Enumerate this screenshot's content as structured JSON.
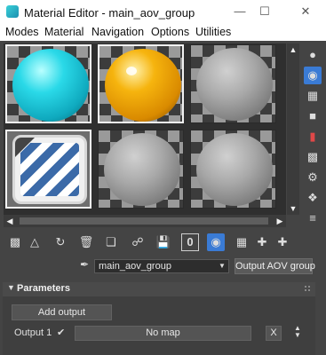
{
  "window": {
    "title": "Material Editor - main_aov_group",
    "controls": [
      "minimize-icon",
      "maximize-icon",
      "close-icon"
    ]
  },
  "menubar": [
    "Modes",
    "Material",
    "Navigation",
    "Options",
    "Utilities"
  ],
  "sample_slots": [
    {
      "preview": "cyan-sphere",
      "active": true
    },
    {
      "preview": "gold-sphere",
      "active": true
    },
    {
      "preview": "grey-sphere",
      "active": false
    },
    {
      "preview": "decal-sticker",
      "active": true
    },
    {
      "preview": "grey-sphere",
      "active": false
    },
    {
      "preview": "grey-sphere",
      "active": false
    }
  ],
  "side_toolbar_icons": [
    "sample-type-icon",
    "backlight-icon",
    "background-icon",
    "uv-tiling-icon",
    "video-color-check-icon",
    "make-preview-icon",
    "options-icon",
    "select-by-material-icon",
    "material-map-navigator-icon"
  ],
  "bottom_toolbar_icons": [
    "get-material-icon",
    "put-to-scene-icon",
    "assign-to-selection-icon",
    "delete-icon",
    "make-unique-icon",
    "put-to-library-icon",
    "save-icon",
    "material-id-icon",
    "show-shaded-icon",
    "show-end-result-icon",
    "go-to-parent-icon",
    "go-forward-icon"
  ],
  "material_id_channel": "0",
  "material": {
    "name": "main_aov_group",
    "type_button": "Output AOV group"
  },
  "parameters": {
    "title": "Parameters",
    "add_output": "Add output",
    "output_label": "Output 1",
    "checkbox_mark": "✔",
    "map_button": "No map",
    "remove_button": "X"
  },
  "colors": {
    "panel_bg": "#444444",
    "accent": "#3a7bd5",
    "cyan_material": "#2ad9e8",
    "gold_material": "#f6b40e"
  }
}
